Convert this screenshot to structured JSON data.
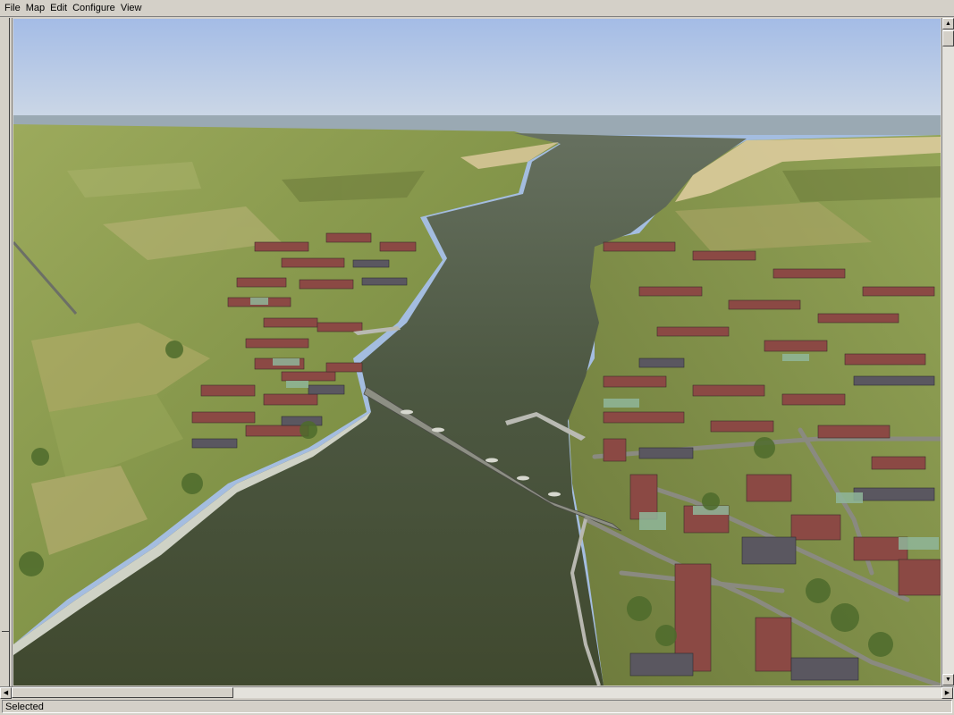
{
  "menubar": {
    "items": [
      {
        "label": "File"
      },
      {
        "label": "Map"
      },
      {
        "label": "Edit"
      },
      {
        "label": "Configure"
      },
      {
        "label": "View"
      }
    ]
  },
  "viewport": {
    "scene": "3d-map-view",
    "colors": {
      "sky_top": "#a6bde6",
      "sky_horizon": "#c9d5e6",
      "water": "#4c5640",
      "land": "#8f9e52",
      "sand": "#d8c89a",
      "roof": "#8e4a45",
      "road": "#8a8a80"
    }
  },
  "scrollbars": {
    "vertical_up_icon": "triangle-up-icon",
    "vertical_down_icon": "triangle-down-icon",
    "horizontal_left_icon": "triangle-left-icon",
    "horizontal_right_icon": "triangle-right-icon"
  },
  "statusbar": {
    "text": "Selected"
  }
}
